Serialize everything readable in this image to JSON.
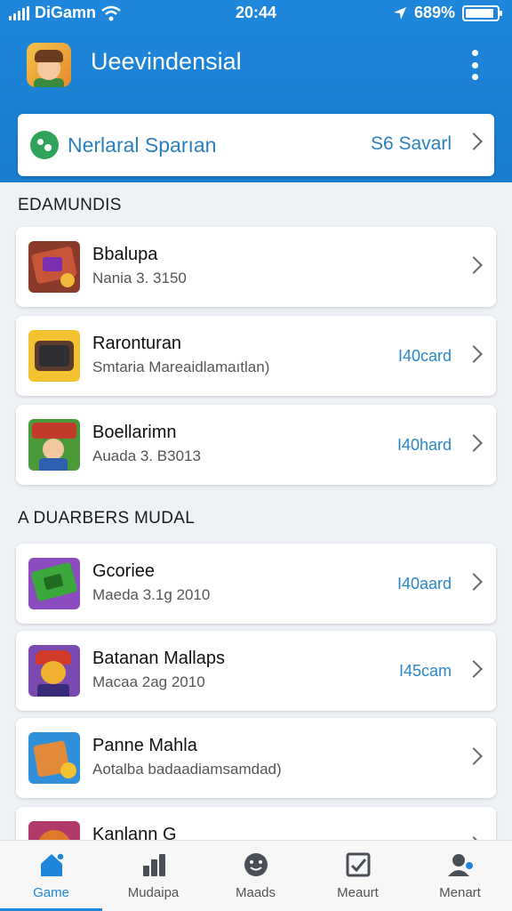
{
  "status_bar": {
    "carrier": "DiGamn",
    "time": "20:44",
    "battery": "689%",
    "battery_level": 0.9
  },
  "app_bar": {
    "title": "Ueevindensial"
  },
  "banner": {
    "title": "Nerlaral Sparıan",
    "right_text": "S6 Savarl"
  },
  "sections": [
    {
      "heading": "EDAMUNDIS",
      "items": [
        {
          "title": "Bbalupa",
          "subtitle": "Nania 3. 3150",
          "right": ""
        },
        {
          "title": "Raronturan",
          "subtitle": "Smtaria Mareaidlamaıtlan)",
          "right": "I40card"
        },
        {
          "title": "Boellarimn",
          "subtitle": "Auada 3. B3013",
          "right": "I40hard"
        }
      ]
    },
    {
      "heading": "A DUARBERS MUDAL",
      "items": [
        {
          "title": "Gcoriee",
          "subtitle": "Maeda 3.1g 2010",
          "right": "I40aard"
        },
        {
          "title": "Batanan Mallaps",
          "subtitle": "Macaa 2ag 2010",
          "right": "I45cam"
        },
        {
          "title": "Panne Mahla",
          "subtitle": "Aotalba badaadiamsamdad)",
          "right": ""
        },
        {
          "title": "Kanlann G",
          "subtitle": "",
          "right": ""
        }
      ]
    }
  ],
  "bottom_nav": [
    {
      "label": "Game",
      "icon": "home-icon",
      "active": true
    },
    {
      "label": "Mudaipa",
      "icon": "chart-icon",
      "active": false
    },
    {
      "label": "Maads",
      "icon": "smiley-icon",
      "active": false
    },
    {
      "label": "Meaurt",
      "icon": "inbox-icon",
      "active": false
    },
    {
      "label": "Menart",
      "icon": "profile-icon",
      "active": false
    }
  ],
  "colors": {
    "primary": "#1e87dc",
    "link": "#2a87c8"
  }
}
